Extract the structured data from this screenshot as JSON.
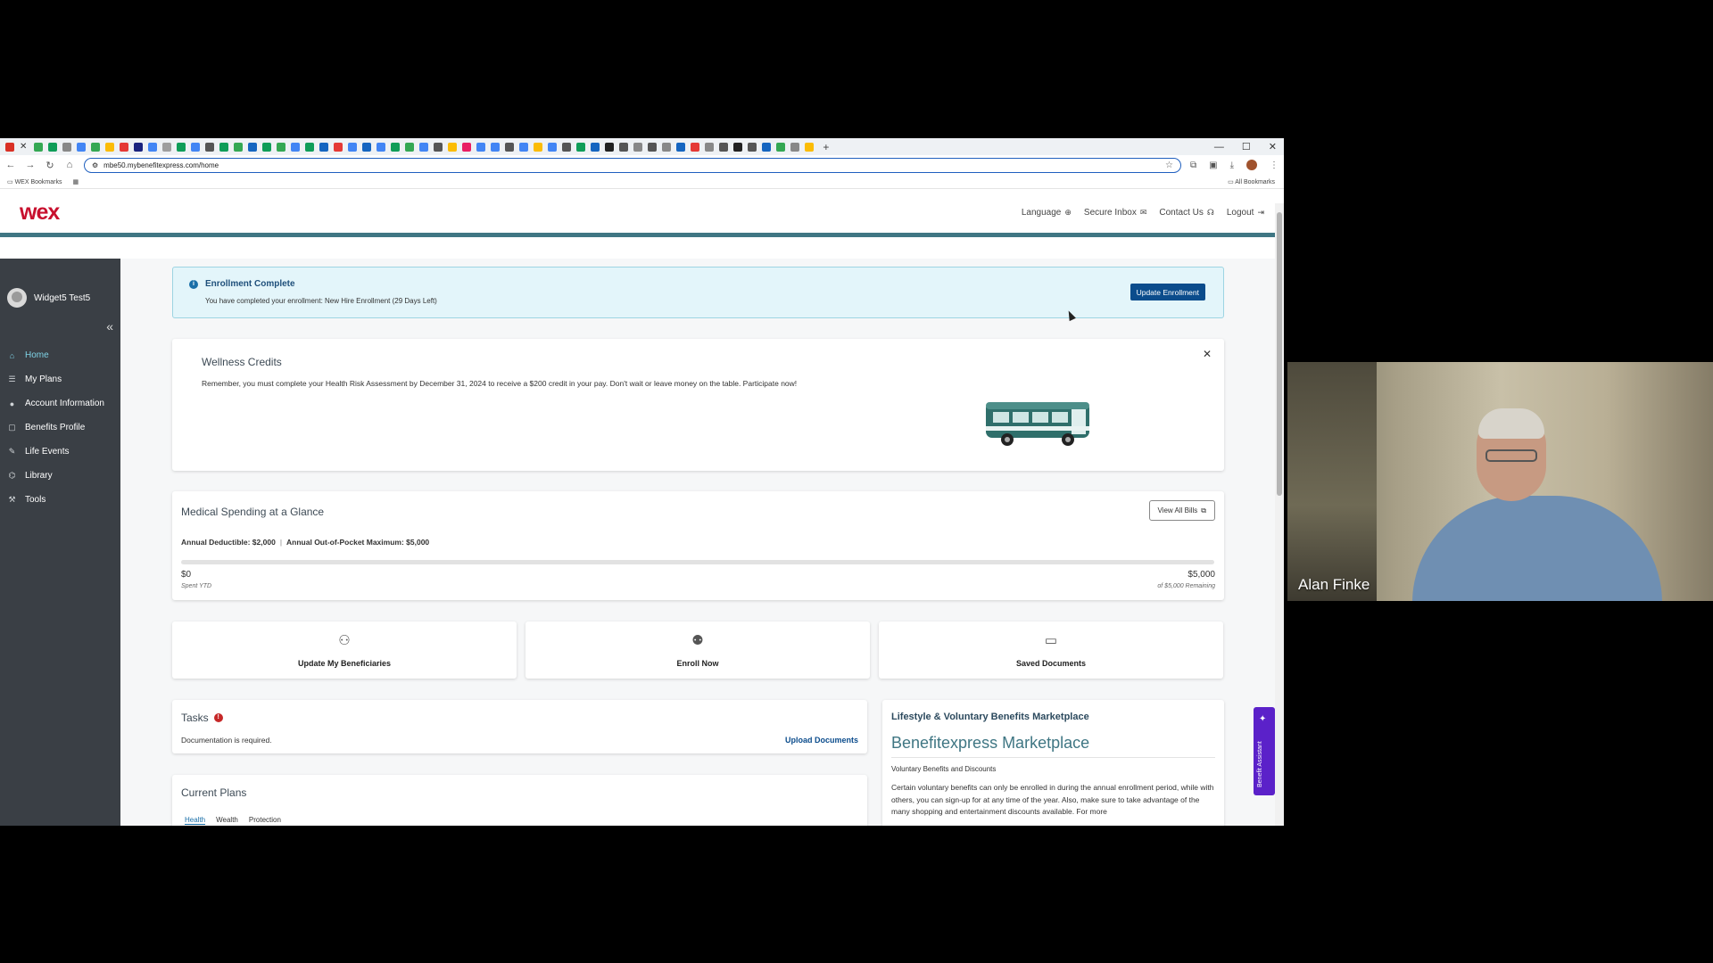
{
  "browser": {
    "url": "mbe50.mybenefitexpress.com/home",
    "bookmarks": {
      "wex": "WEX Bookmarks",
      "all": "All Bookmarks"
    }
  },
  "header": {
    "logo": "wex",
    "nav": {
      "language": "Language",
      "inbox": "Secure Inbox",
      "contact": "Contact Us",
      "logout": "Logout"
    }
  },
  "sidebar": {
    "user_name": "Widget5 Test5",
    "items": [
      {
        "label": "Home",
        "icon": "home-icon",
        "active": true
      },
      {
        "label": "My Plans",
        "icon": "list-icon"
      },
      {
        "label": "Account Information",
        "icon": "person-icon"
      },
      {
        "label": "Benefits Profile",
        "icon": "profile-icon"
      },
      {
        "label": "Life Events",
        "icon": "edit-icon"
      },
      {
        "label": "Library",
        "icon": "book-icon"
      },
      {
        "label": "Tools",
        "icon": "wrench-icon"
      }
    ]
  },
  "alert": {
    "title": "Enrollment Complete",
    "text": "You have completed your enrollment: New Hire Enrollment (29 Days Left)",
    "button": "Update Enrollment"
  },
  "wellness": {
    "title": "Wellness Credits",
    "text": "Remember, you must complete your Health Risk Assessment by December 31, 2024 to receive a $200 credit in your pay. Don't wait or leave money on the table. Participate now!"
  },
  "medical": {
    "title": "Medical Spending at a Glance",
    "view_all": "View All Bills",
    "deductible": "Annual Deductible: $2,000",
    "oop": "Annual Out-of-Pocket Maximum: $5,000",
    "spent": "$0",
    "spent_label": "Spent YTD",
    "max": "$5,000",
    "remaining_label": "of $5,000 Remaining",
    "progress_fraction": 0
  },
  "quick_actions": [
    {
      "label": "Update My Beneficiaries",
      "icon": "add-person-icon"
    },
    {
      "label": "Enroll Now",
      "icon": "person-settings-icon"
    },
    {
      "label": "Saved Documents",
      "icon": "folder-icon"
    }
  ],
  "tasks": {
    "title": "Tasks",
    "badge": "!",
    "item": "Documentation is required.",
    "link": "Upload Documents"
  },
  "plans": {
    "title": "Current Plans",
    "tabs": [
      "Health",
      "Wealth",
      "Protection"
    ]
  },
  "marketplace": {
    "title": "Lifestyle & Voluntary Benefits Marketplace",
    "heading": "Benefitexpress Marketplace",
    "subtitle": "Voluntary Benefits and Discounts",
    "body": "Certain voluntary benefits can only be enrolled in during the annual enrollment period, while with others, you can sign-up for at any time of the year. Also, make sure to take advantage of the many shopping and entertainment discounts available. For more"
  },
  "assistant": {
    "label": "Benefit Assistant"
  },
  "video": {
    "participant": "Alan Finke"
  },
  "colors": {
    "accent": "#3f7683",
    "primary": "#0b4c8c",
    "brand": "#c8102e",
    "sidebar": "#3a3f45"
  }
}
